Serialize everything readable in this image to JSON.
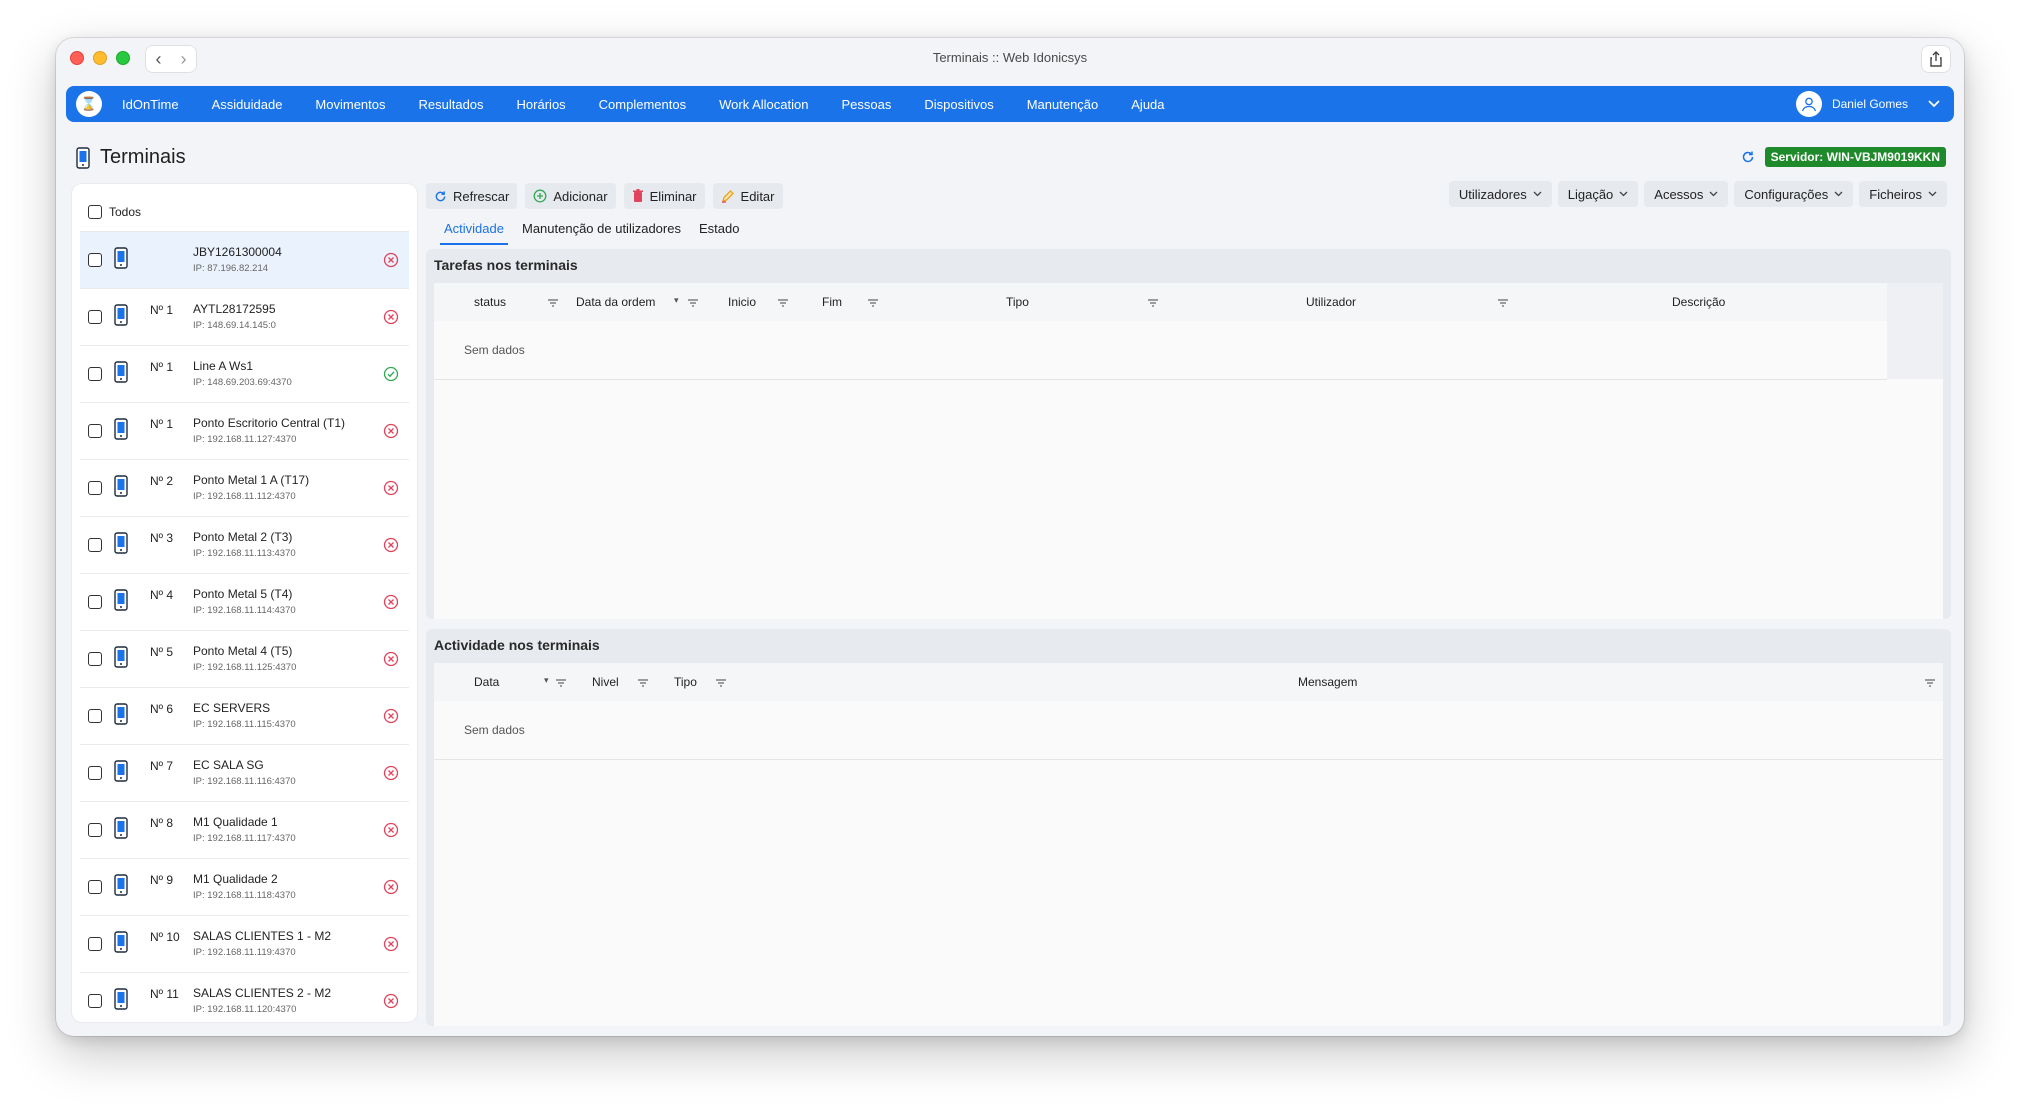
{
  "window": {
    "title": "Terminais :: Web Idonicsys"
  },
  "nav": {
    "items": [
      "IdOnTime",
      "Assiduidade",
      "Movimentos",
      "Resultados",
      "Horários",
      "Complementos",
      "Work Allocation",
      "Pessoas",
      "Dispositivos",
      "Manutenção",
      "Ajuda"
    ],
    "user": "Daniel Gomes",
    "accent": "#1a73e8"
  },
  "page": {
    "title": "Terminais",
    "server_label": "Servidor: WIN-VBJM9019KKN",
    "server_color": "#1f8a2b"
  },
  "terminal_list": {
    "select_all_label": "Todos",
    "items": [
      {
        "num": "",
        "name": "JBY1261300004",
        "ip": "IP: 87.196.82.214",
        "status": "error",
        "selected": true
      },
      {
        "num": "Nº 1",
        "name": "AYTL28172595",
        "ip": "IP: 148.69.14.145:0",
        "status": "error"
      },
      {
        "num": "Nº 1",
        "name": "Line A Ws1",
        "ip": "IP: 148.69.203.69:4370",
        "status": "ok"
      },
      {
        "num": "Nº 1",
        "name": "Ponto Escritorio Central (T1)",
        "ip": "IP: 192.168.11.127:4370",
        "status": "error"
      },
      {
        "num": "Nº 2",
        "name": "Ponto Metal 1 A (T17)",
        "ip": "IP: 192.168.11.112:4370",
        "status": "error"
      },
      {
        "num": "Nº 3",
        "name": "Ponto Metal 2 (T3)",
        "ip": "IP: 192.168.11.113:4370",
        "status": "error"
      },
      {
        "num": "Nº 4",
        "name": "Ponto Metal 5 (T4)",
        "ip": "IP: 192.168.11.114:4370",
        "status": "error"
      },
      {
        "num": "Nº 5",
        "name": "Ponto Metal 4 (T5)",
        "ip": "IP: 192.168.11.125:4370",
        "status": "error"
      },
      {
        "num": "Nº 6",
        "name": "EC SERVERS",
        "ip": "IP: 192.168.11.115:4370",
        "status": "error"
      },
      {
        "num": "Nº 7",
        "name": "EC SALA SG",
        "ip": "IP: 192.168.11.116:4370",
        "status": "error"
      },
      {
        "num": "Nº 8",
        "name": "M1 Qualidade 1",
        "ip": "IP: 192.168.11.117:4370",
        "status": "error"
      },
      {
        "num": "Nº 9",
        "name": "M1 Qualidade 2",
        "ip": "IP: 192.168.11.118:4370",
        "status": "error"
      },
      {
        "num": "Nº 10",
        "name": "SALAS CLIENTES 1 - M2",
        "ip": "IP: 192.168.11.119:4370",
        "status": "error"
      },
      {
        "num": "Nº 11",
        "name": "SALAS CLIENTES 2 - M2",
        "ip": "IP: 192.168.11.120:4370",
        "status": "error"
      }
    ]
  },
  "toolbar": {
    "refresh": "Refrescar",
    "add": "Adicionar",
    "delete": "Eliminar",
    "edit": "Editar",
    "menus": [
      "Utilizadores",
      "Ligação",
      "Acessos",
      "Configurações",
      "Ficheiros"
    ]
  },
  "tabs": [
    "Actividade",
    "Manutenção de utilizadores",
    "Estado"
  ],
  "tasks": {
    "title": "Tarefas nos terminais",
    "columns": [
      "status",
      "Data da ordem",
      "Inicio",
      "Fim",
      "Tipo",
      "Utilizador",
      "Descrição"
    ],
    "empty": "Sem dados"
  },
  "activity": {
    "title": "Actividade nos terminais",
    "columns": [
      "Data",
      "Nivel",
      "Tipo",
      "Mensagem"
    ],
    "empty": "Sem dados"
  },
  "colors": {
    "error": "#e0435b",
    "ok": "#34a853",
    "device": "#1a73e8"
  }
}
